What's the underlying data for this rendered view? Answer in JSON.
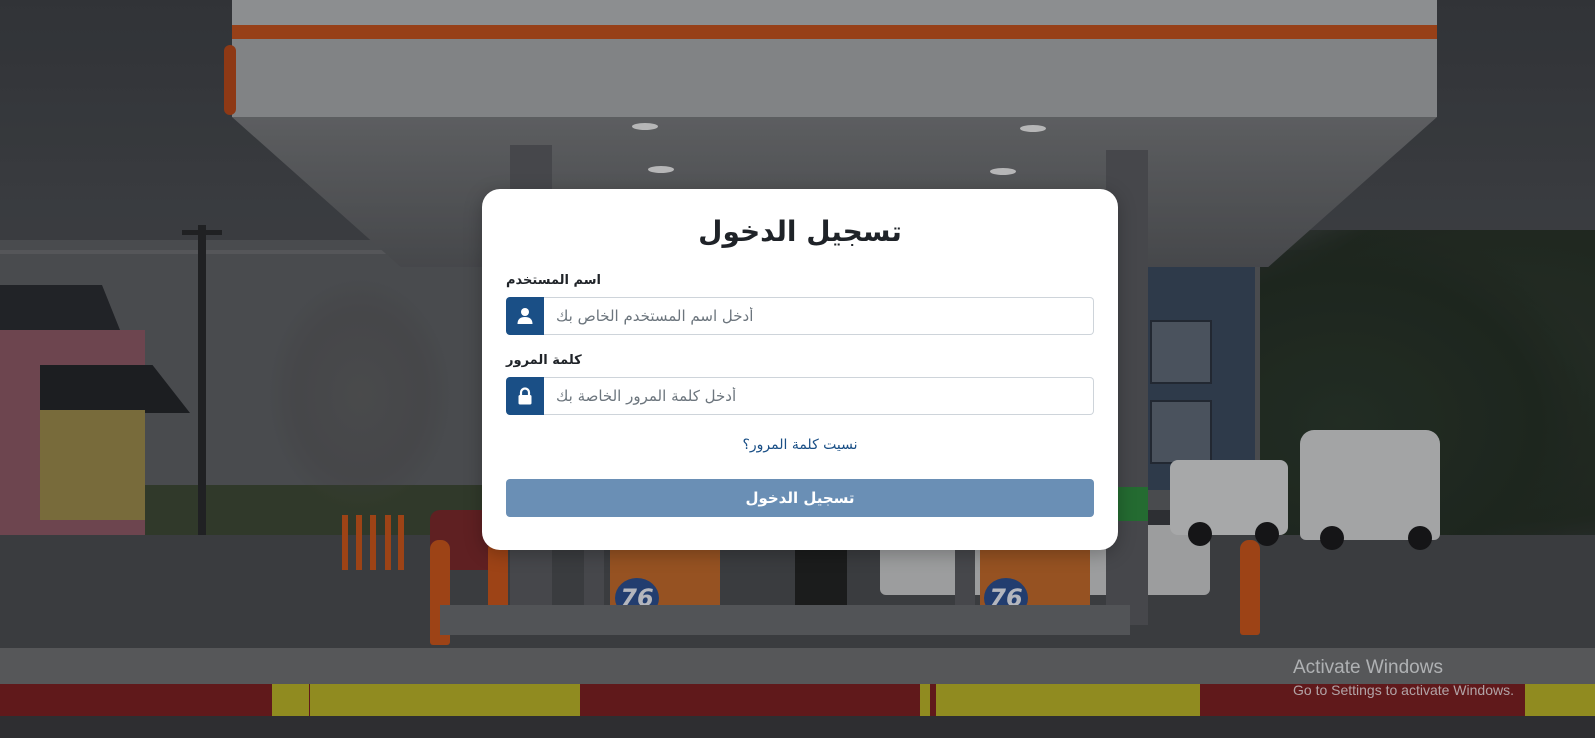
{
  "login": {
    "title": "تسجيل الدخول",
    "username_label": "اسم المستخدم",
    "username_placeholder": "أدخل اسم المستخدم الخاص بك",
    "password_label": "كلمة المرور",
    "password_placeholder": "أدخل كلمة المرور الخاصة بك",
    "forgot_link": "نسيت كلمة المرور؟",
    "submit_label": "تسجيل الدخول",
    "username_icon": "user-icon",
    "password_icon": "lock-icon"
  },
  "background": {
    "pump_brand": "76"
  },
  "watermark": {
    "title": "Activate Windows",
    "subtitle": "Go to Settings to activate Windows."
  },
  "colors": {
    "primary": "#1a4f86",
    "button": "#6a8fb5",
    "card": "#ffffff"
  }
}
